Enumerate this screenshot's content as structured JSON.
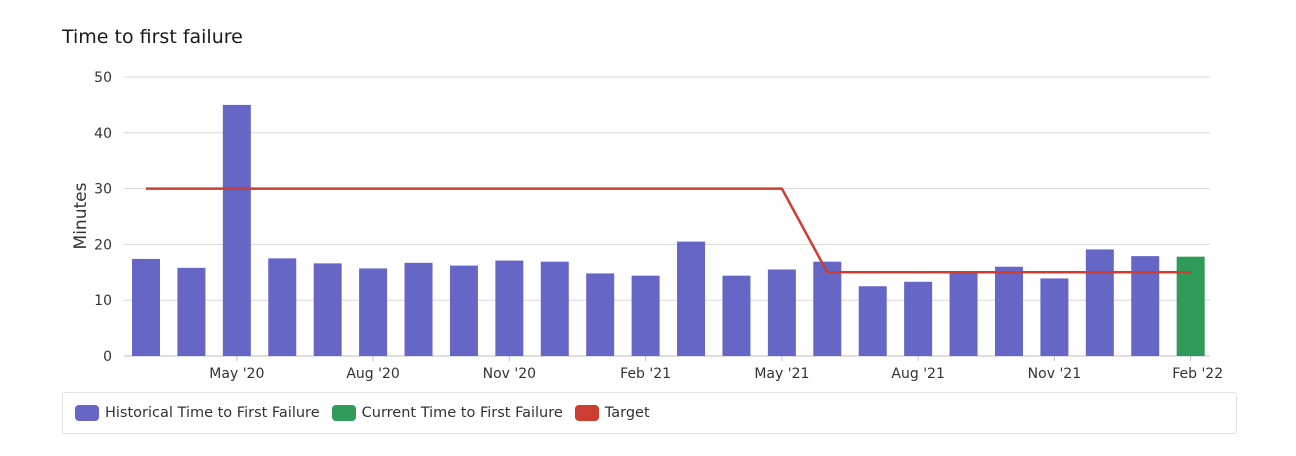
{
  "chart_data": {
    "type": "bar",
    "title": "Time to first failure",
    "ylabel": "Minutes",
    "xlabel": "",
    "ylim": [
      0,
      50
    ],
    "yticks": [
      0,
      10,
      20,
      30,
      40,
      50
    ],
    "grid": true,
    "legend_position": "bottom",
    "categories": [
      "Mar '20",
      "Apr '20",
      "May '20",
      "Jun '20",
      "Jul '20",
      "Aug '20",
      "Sep '20",
      "Oct '20",
      "Nov '20",
      "Dec '20",
      "Jan '21",
      "Feb '21",
      "Mar '21",
      "Apr '21",
      "May '21",
      "Jun '21",
      "Jul '21",
      "Aug '21",
      "Sep '21",
      "Oct '21",
      "Nov '21",
      "Dec '21",
      "Jan '22",
      "Feb '22"
    ],
    "tick_labels": [
      "",
      "",
      "May '20",
      "",
      "",
      "Aug '20",
      "",
      "",
      "Nov '20",
      "",
      "",
      "Feb '21",
      "",
      "",
      "May '21",
      "",
      "",
      "Aug '21",
      "",
      "",
      "Nov '21",
      "",
      "",
      "Feb '22"
    ],
    "series": [
      {
        "name": "Historical Time to First Failure",
        "kind": "bar",
        "color": "#6666c6",
        "values": [
          17.4,
          15.8,
          45.0,
          17.5,
          16.6,
          15.7,
          16.7,
          16.2,
          17.1,
          16.9,
          14.8,
          14.4,
          20.5,
          14.4,
          15.5,
          16.9,
          12.5,
          13.3,
          15.2,
          16.0,
          13.9,
          19.1,
          17.9,
          null
        ]
      },
      {
        "name": "Current Time to First Failure",
        "kind": "bar",
        "color": "#2f9a5a",
        "values": [
          null,
          null,
          null,
          null,
          null,
          null,
          null,
          null,
          null,
          null,
          null,
          null,
          null,
          null,
          null,
          null,
          null,
          null,
          null,
          null,
          null,
          null,
          null,
          17.8
        ]
      },
      {
        "name": "Target",
        "kind": "line",
        "color": "#cc3d32",
        "values": [
          30,
          30,
          30,
          30,
          30,
          30,
          30,
          30,
          30,
          30,
          30,
          30,
          30,
          30,
          30,
          15,
          15,
          15,
          15,
          15,
          15,
          15,
          15,
          15
        ]
      }
    ]
  }
}
